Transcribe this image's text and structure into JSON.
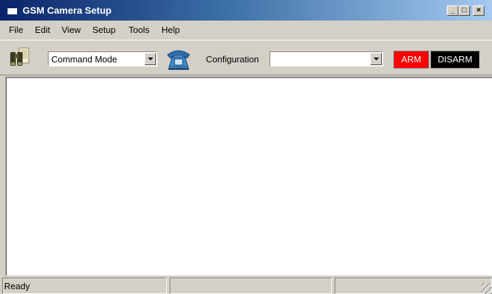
{
  "window": {
    "title": "GSM Camera Setup",
    "minimize": "_",
    "maximize": "□",
    "close": "×"
  },
  "menu": [
    "File",
    "Edit",
    "View",
    "Setup",
    "Tools",
    "Help"
  ],
  "toolbar": {
    "binoculars_icon": "binoculars-icon",
    "mode_combo": {
      "value": "Command Mode"
    },
    "phone_icon": "telephone-icon",
    "configuration_label": "Configuration",
    "configuration_combo": {
      "value": ""
    },
    "arm_label": "ARM",
    "disarm_label": "DISARM",
    "arm_color": "#ff0000",
    "disarm_color": "#000000"
  },
  "status": {
    "panes": [
      "Ready",
      "",
      ""
    ]
  }
}
